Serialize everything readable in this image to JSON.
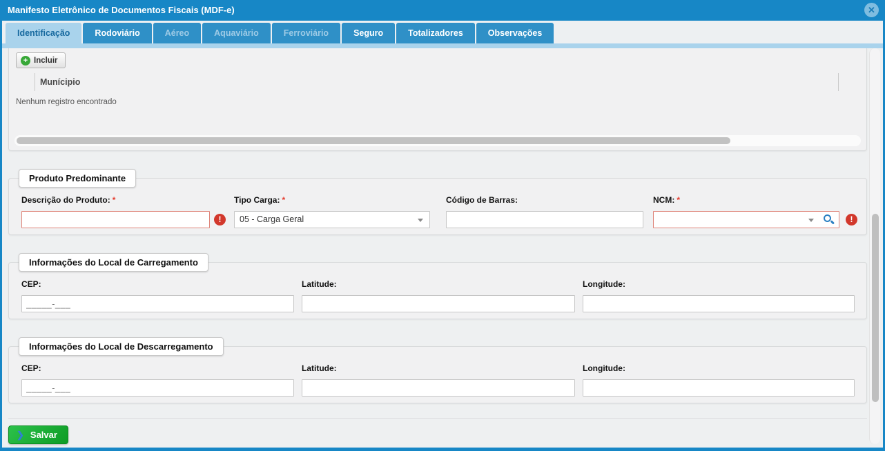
{
  "window": {
    "title": "Manifesto Eletrônico de Documentos Fiscais (MDF-e)"
  },
  "icons": {
    "close_glyph": "✕",
    "plus_glyph": "+",
    "error_glyph": "!",
    "chevron_glyph": "❯"
  },
  "ui": {
    "required_marker": "*"
  },
  "tabs": [
    {
      "label": "Identificação",
      "state": "active"
    },
    {
      "label": "Rodoviário",
      "state": "enabled"
    },
    {
      "label": "Aéreo",
      "state": "disabled"
    },
    {
      "label": "Aquaviário",
      "state": "disabled"
    },
    {
      "label": "Ferroviário",
      "state": "disabled"
    },
    {
      "label": "Seguro",
      "state": "enabled"
    },
    {
      "label": "Totalizadores",
      "state": "enabled"
    },
    {
      "label": "Observações",
      "state": "enabled"
    }
  ],
  "municipios_grid": {
    "incluir_label": "Incluir",
    "column_header": "Munícipio",
    "empty_message": "Nenhum registro encontrado"
  },
  "produto_predominante": {
    "legend": "Produto Predominante",
    "descricao": {
      "label": "Descrição do Produto:",
      "value": "",
      "required": true,
      "error": true
    },
    "tipo_carga": {
      "label": "Tipo Carga:",
      "value": "05 - Carga Geral",
      "required": true
    },
    "codigo_barras": {
      "label": "Código de Barras:",
      "value": ""
    },
    "ncm": {
      "label": "NCM:",
      "value": "",
      "required": true,
      "error": true
    }
  },
  "local_carregamento": {
    "legend": "Informações do Local de Carregamento",
    "cep": {
      "label": "CEP:",
      "mask": "_____-___"
    },
    "latitude": {
      "label": "Latitude:",
      "value": ""
    },
    "longitude": {
      "label": "Longitude:",
      "value": ""
    }
  },
  "local_descarregamento": {
    "legend": "Informações do Local de Descarregamento",
    "cep": {
      "label": "CEP:",
      "mask": "_____-___"
    },
    "latitude": {
      "label": "Latitude:",
      "value": ""
    },
    "longitude": {
      "label": "Longitude:",
      "value": ""
    }
  },
  "footer": {
    "salvar_label": "Salvar"
  },
  "colors": {
    "titlebar_blue": "#1787c6",
    "tab_blue": "#2f90c7",
    "tab_active_bg": "#a9d3ec",
    "tab_active_text": "#16699f",
    "error_red": "#d2382c",
    "error_field_border": "#de8378",
    "incluir_green": "#38a838",
    "salvar_green": "#0d9c25",
    "search_blue": "#2b80c2"
  }
}
